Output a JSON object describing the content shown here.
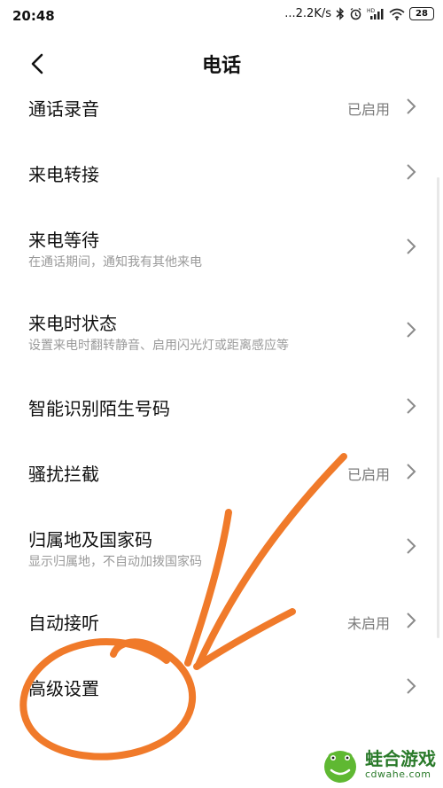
{
  "status_bar": {
    "time": "20:48",
    "network_speed": "...2.2K/s",
    "icons": [
      "bluetooth-icon",
      "alarm-icon",
      "hd-signal-icon",
      "wifi-icon"
    ],
    "battery": "28"
  },
  "header": {
    "back_icon": "chevron-left-icon",
    "title": "电话"
  },
  "settings": {
    "items": [
      {
        "title": "通话录音",
        "subtitle": "",
        "value": "已启用"
      },
      {
        "title": "来电转接",
        "subtitle": "",
        "value": ""
      },
      {
        "title": "来电等待",
        "subtitle": "在通话期间，通知我有其他来电",
        "value": ""
      },
      {
        "title": "来电时状态",
        "subtitle": "设置来电时翻转静音、启用闪光灯或距离感应等",
        "value": ""
      },
      {
        "title": "智能识别陌生号码",
        "subtitle": "",
        "value": ""
      },
      {
        "title": "骚扰拦截",
        "subtitle": "",
        "value": "已启用"
      },
      {
        "title": "归属地及国家码",
        "subtitle": "显示归属地，不自动加拨国家码",
        "value": ""
      },
      {
        "title": "自动接听",
        "subtitle": "",
        "value": "未启用"
      },
      {
        "title": "高级设置",
        "subtitle": "",
        "value": ""
      }
    ]
  },
  "annotation": {
    "color": "#f07a2a",
    "shapes": [
      "circle-around-advanced-settings",
      "arrow-pointing-to-advanced-settings"
    ]
  },
  "watermark": {
    "name": "蛙合游戏",
    "url": "cdwahe.com"
  }
}
